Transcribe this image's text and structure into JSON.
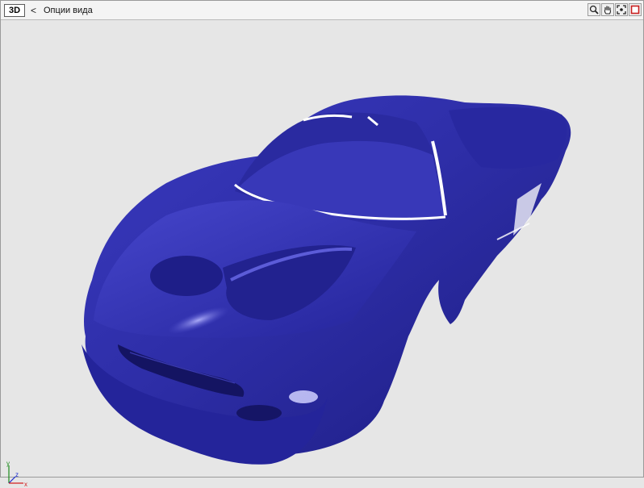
{
  "viewer": {
    "mode_label": "3D",
    "back_glyph": "<",
    "view_options_label": "Опции вида"
  },
  "toolbar": {
    "tools": [
      "zoom-icon",
      "pan-hand-icon",
      "fit-view-icon",
      "maximize-window-icon"
    ]
  },
  "axes": {
    "y_label": "y",
    "z_label": "z",
    "x_label": "x"
  },
  "colors": {
    "model": "#2e2ea8",
    "viewport_background": "#e6e6e6",
    "axis_x": "#d22020",
    "axis_y": "#1a8a1a",
    "axis_z": "#1a2ad0",
    "maximize_accent": "#c81e1e"
  }
}
